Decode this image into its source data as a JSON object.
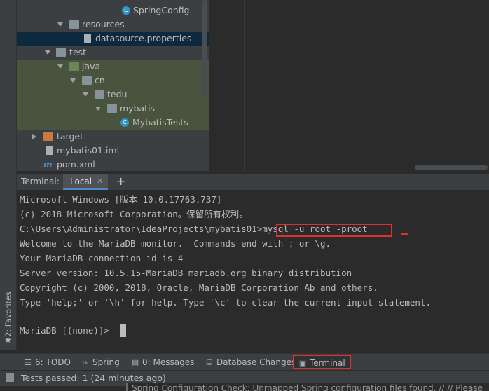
{
  "sidebar": {
    "favorites_label": "2: Favorites"
  },
  "tree": {
    "items": [
      {
        "label": "SpringConfig",
        "icon": "class-icon"
      },
      {
        "label": "resources",
        "icon": "resources-folder-icon"
      },
      {
        "label": "datasource.properties",
        "icon": "properties-file-icon"
      },
      {
        "label": "test",
        "icon": "folder-icon"
      },
      {
        "label": "java",
        "icon": "test-source-folder-icon"
      },
      {
        "label": "cn",
        "icon": "package-icon"
      },
      {
        "label": "tedu",
        "icon": "package-icon"
      },
      {
        "label": "mybatis",
        "icon": "package-icon"
      },
      {
        "label": "MybatisTests",
        "icon": "class-icon"
      },
      {
        "label": "target",
        "icon": "excluded-folder-icon"
      },
      {
        "label": "mybatis01.iml",
        "icon": "module-file-icon"
      },
      {
        "label": "pom.xml",
        "icon": "maven-icon"
      }
    ]
  },
  "terminal": {
    "title": "Terminal:",
    "tab_label": "Local",
    "lines": [
      "Microsoft Windows [版本 10.0.17763.737]",
      "(c) 2018 Microsoft Corporation。保留所有权利。",
      "",
      "Welcome to the MariaDB monitor.  Commands end with ; or \\g.",
      "Your MariaDB connection id is 4",
      "Server version: 10.5.15-MariaDB mariadb.org binary distribution",
      "Copyright (c) 2000, 2018, Oracle, MariaDB Corporation Ab and others.",
      "Type 'help;' or '\\h' for help. Type '\\c' to clear the current input statement.",
      "",
      "MariaDB [(none)]> "
    ],
    "prompt_path": "C:\\Users\\Administrator\\IdeaProjects\\mybatis01>",
    "command": "mysql -u root -proot"
  },
  "toolwindows": {
    "todo": "6: TODO",
    "spring": "Spring",
    "messages": "0: Messages",
    "database": "Database Changes",
    "terminal": "Terminal"
  },
  "status": {
    "text": "Tests passed: 1 (24 minutes ago)",
    "notification": "Spring Configuration Check: Unmapped Spring configuration files found. // // Please"
  },
  "colors": {
    "highlight": "#e0302e",
    "accent": "#4a88c7"
  }
}
